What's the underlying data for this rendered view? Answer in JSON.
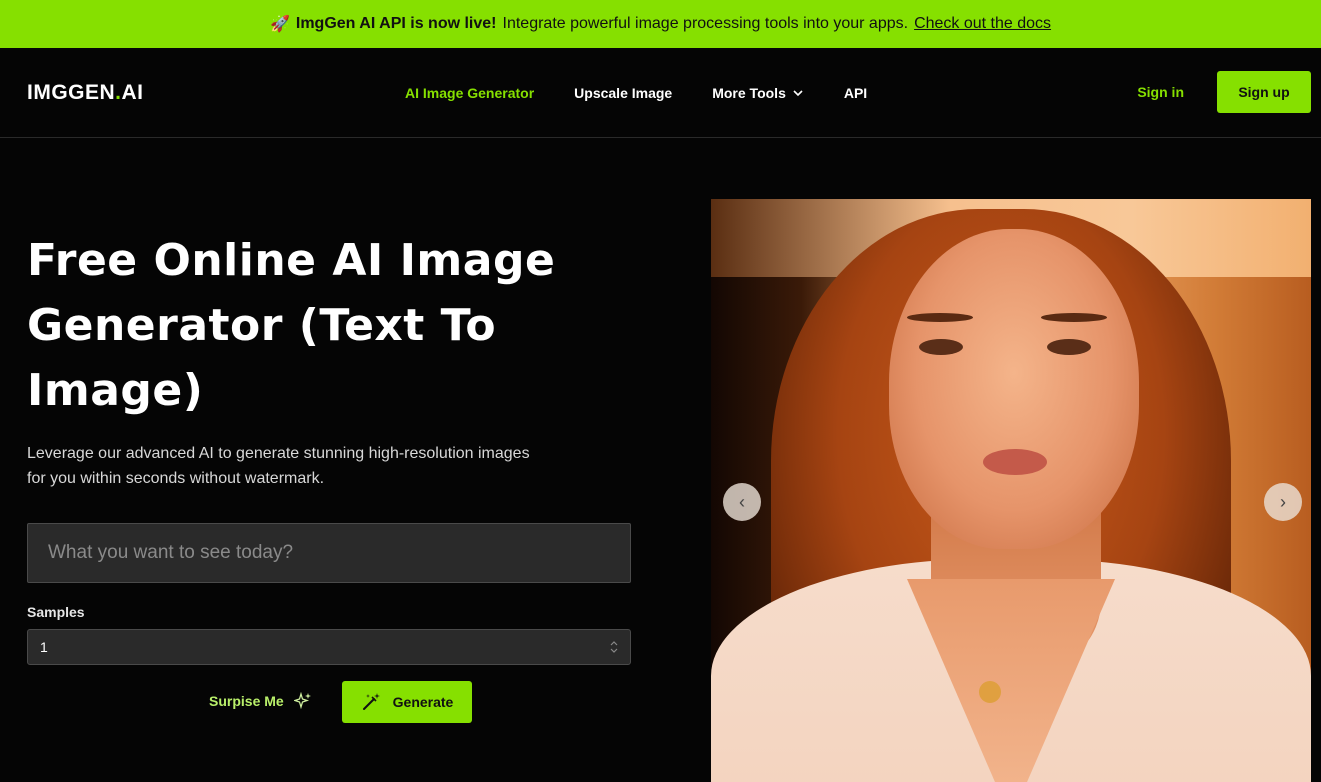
{
  "banner": {
    "emoji": "🚀",
    "headline": "ImgGen AI API is now live!",
    "text": "Integrate powerful image processing tools into your apps.",
    "link": "Check out the docs"
  },
  "nav": {
    "logo_main": "IMGGEN",
    "logo_dot": ".",
    "logo_end": "AI",
    "items": [
      "AI Image Generator",
      "Upscale Image",
      "More Tools",
      "API"
    ],
    "sign_in": "Sign in",
    "sign_up": "Sign up"
  },
  "hero": {
    "title": "Free Online AI Image Generator (Text To Image)",
    "subtitle": "Leverage our advanced AI to generate stunning high-resolution images for you within seconds without watermark."
  },
  "form": {
    "prompt_placeholder": "What you want to see today?",
    "samples_label": "Samples",
    "samples_value": "1",
    "surprise": "Surpise Me",
    "generate": "Generate"
  },
  "carousel": {
    "prev": "‹",
    "next": "›"
  },
  "colors": {
    "accent": "#86e000",
    "background": "#050505"
  }
}
